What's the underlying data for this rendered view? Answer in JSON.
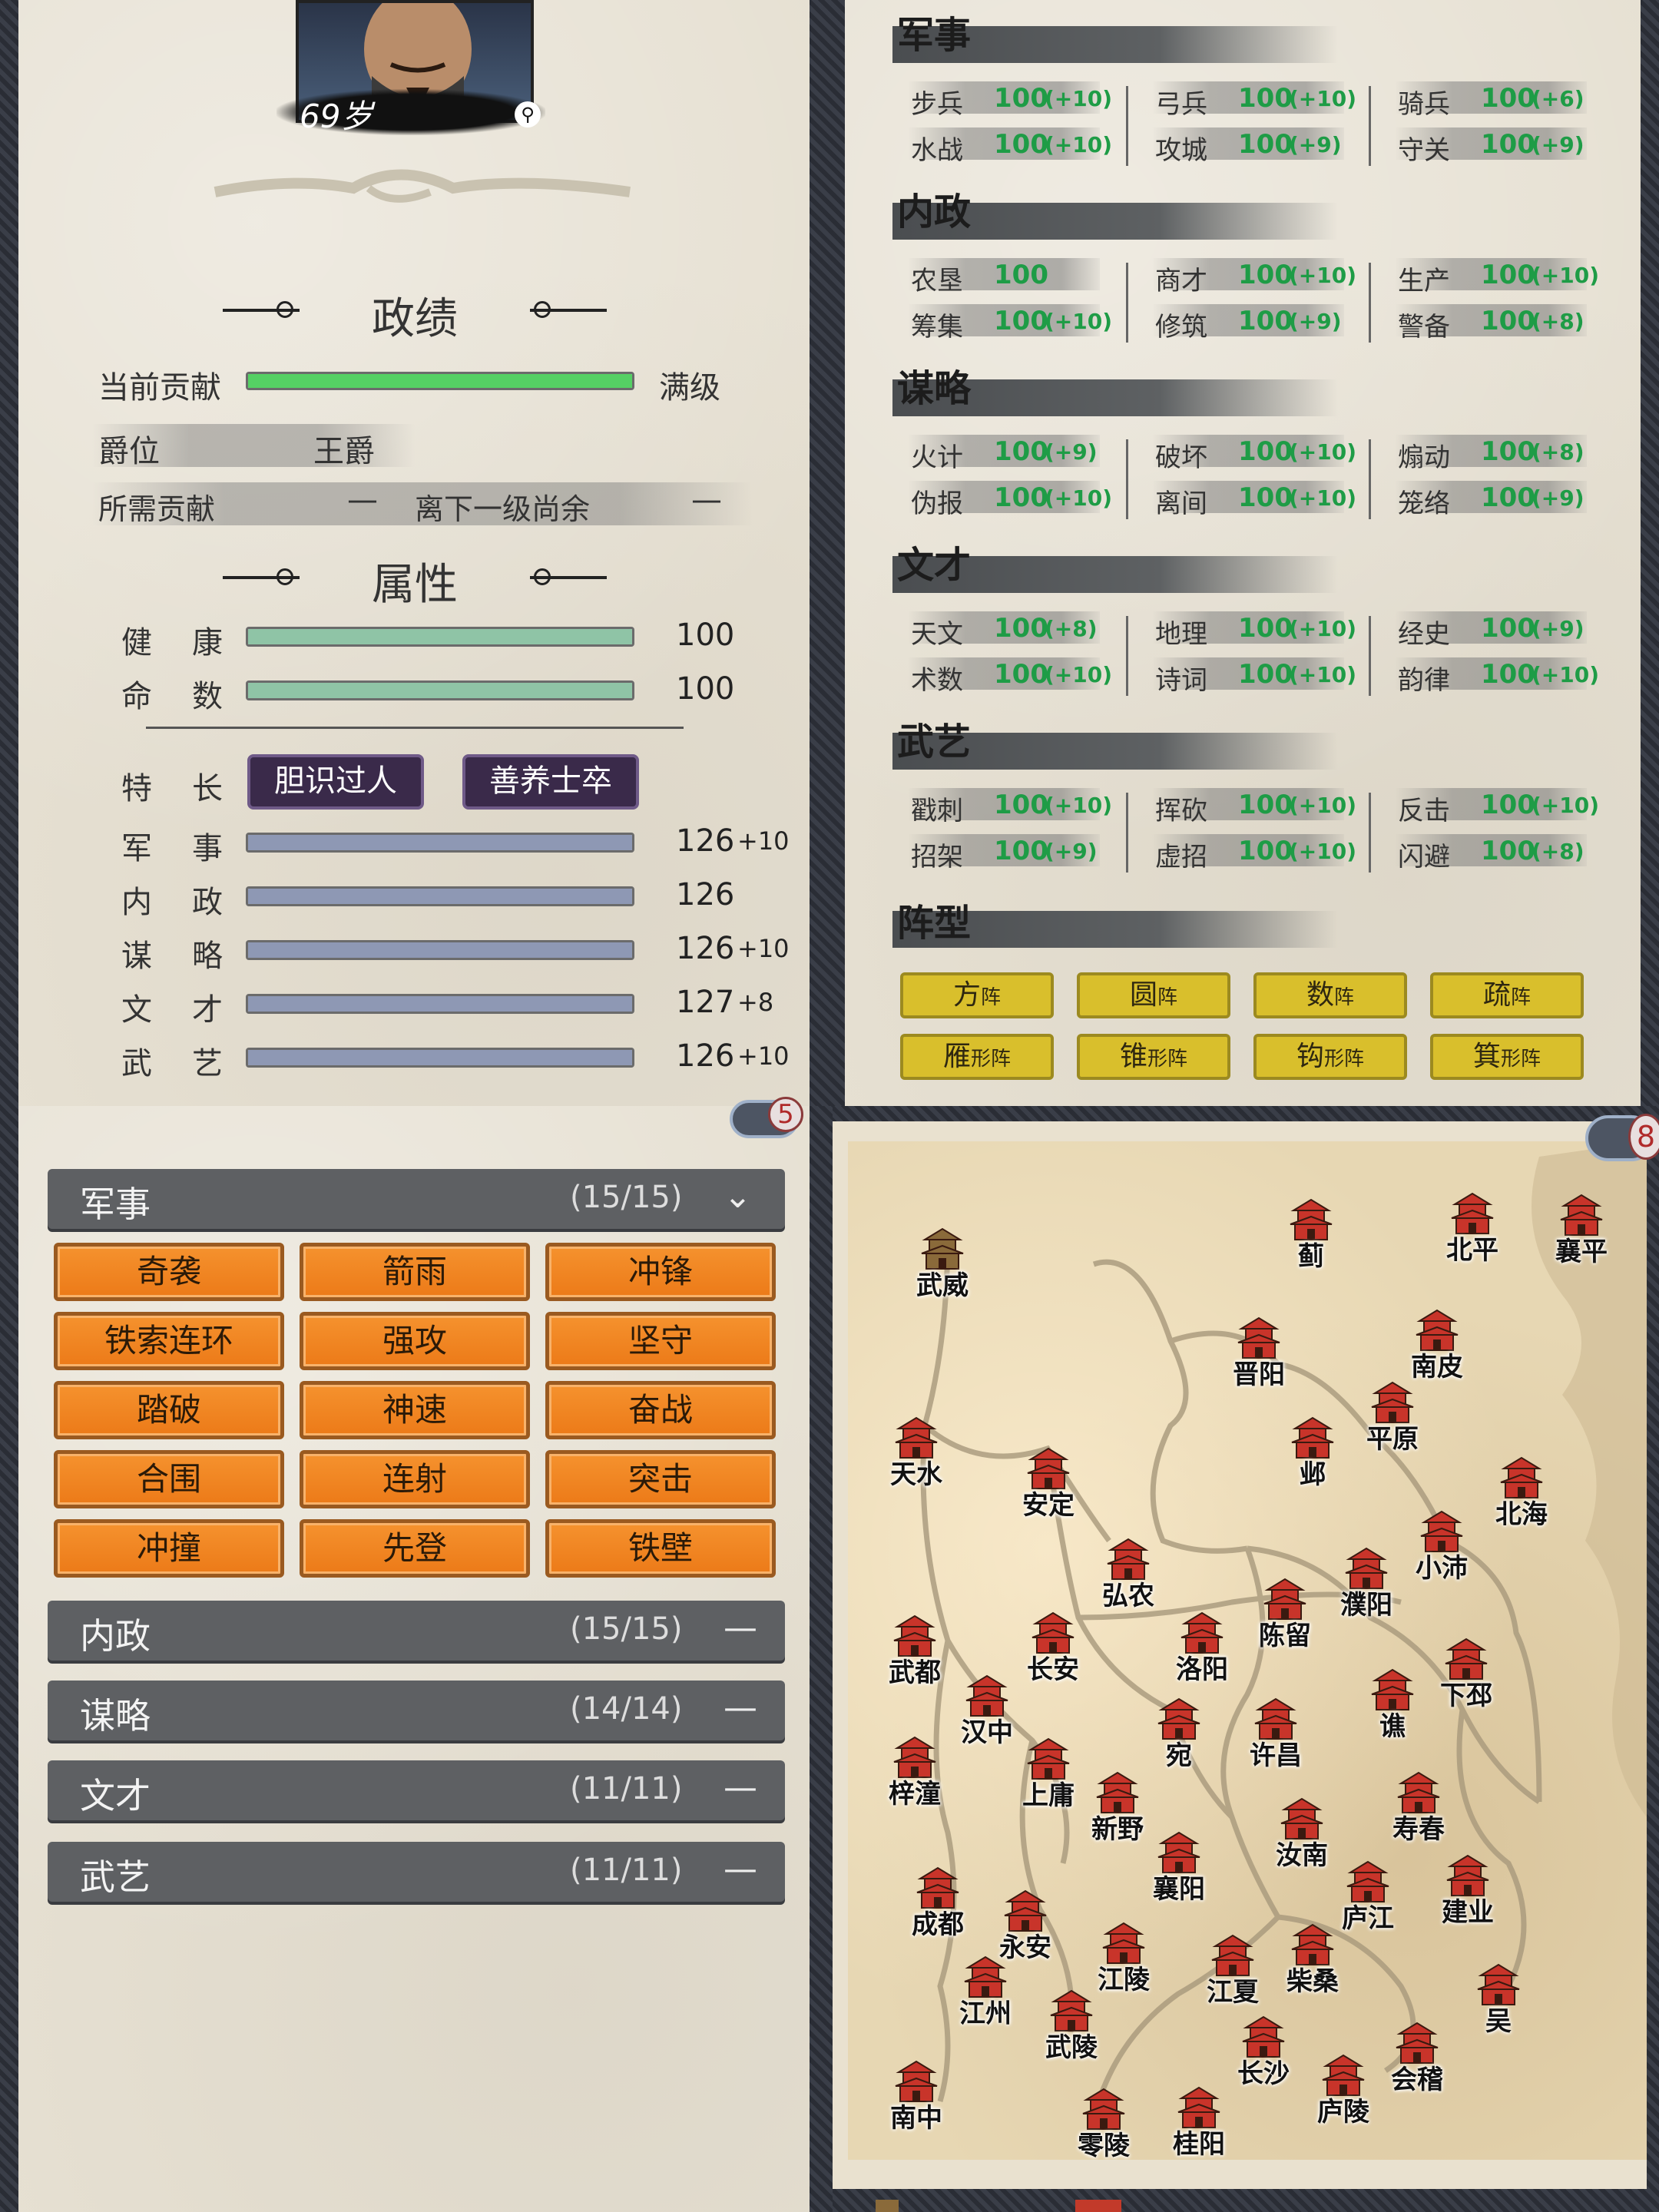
{
  "portrait": {
    "age": "69岁"
  },
  "achievement": {
    "title": "政绩",
    "contribution_label": "当前贡献",
    "contribution_status": "满级",
    "contribution_fill": 1.0,
    "rank_label": "爵位",
    "rank_value": "王爵",
    "needed_label": "所需贡献",
    "needed_value": "—",
    "remain_label": "离下一级尚余",
    "remain_value": "—"
  },
  "attributes": {
    "title": "属性",
    "health": {
      "label1": "健",
      "label2": "康",
      "value": "100",
      "fill": 1.0
    },
    "fate": {
      "label1": "命",
      "label2": "数",
      "value": "100",
      "fill": 1.0
    },
    "specialty": {
      "label1": "特",
      "label2": "长",
      "tags": [
        "胆识过人",
        "善养士卒"
      ]
    },
    "stats": [
      {
        "l1": "军",
        "l2": "事",
        "value": "126",
        "bonus": "+10"
      },
      {
        "l1": "内",
        "l2": "政",
        "value": "126",
        "bonus": ""
      },
      {
        "l1": "谋",
        "l2": "略",
        "value": "126",
        "bonus": "+10"
      },
      {
        "l1": "文",
        "l2": "才",
        "value": "127",
        "bonus": "+8"
      },
      {
        "l1": "武",
        "l2": "艺",
        "value": "126",
        "bonus": "+10"
      }
    ]
  },
  "skills": {
    "sections": [
      {
        "name": "军事",
        "rows": [
          [
            {
              "n": "步兵",
              "v": "100",
              "b": "(+10)"
            },
            {
              "n": "弓兵",
              "v": "100",
              "b": "(+10)"
            },
            {
              "n": "骑兵",
              "v": "100",
              "b": "(+6)"
            }
          ],
          [
            {
              "n": "水战",
              "v": "100",
              "b": "(+10)"
            },
            {
              "n": "攻城",
              "v": "100",
              "b": "(+9)"
            },
            {
              "n": "守关",
              "v": "100",
              "b": "(+9)"
            }
          ]
        ]
      },
      {
        "name": "内政",
        "rows": [
          [
            {
              "n": "农垦",
              "v": "100",
              "b": ""
            },
            {
              "n": "商才",
              "v": "100",
              "b": "(+10)"
            },
            {
              "n": "生产",
              "v": "100",
              "b": "(+10)"
            }
          ],
          [
            {
              "n": "筹集",
              "v": "100",
              "b": "(+10)"
            },
            {
              "n": "修筑",
              "v": "100",
              "b": "(+9)"
            },
            {
              "n": "警备",
              "v": "100",
              "b": "(+8)"
            }
          ]
        ]
      },
      {
        "name": "谋略",
        "rows": [
          [
            {
              "n": "火计",
              "v": "100",
              "b": "(+9)"
            },
            {
              "n": "破坏",
              "v": "100",
              "b": "(+10)"
            },
            {
              "n": "煽动",
              "v": "100",
              "b": "(+8)"
            }
          ],
          [
            {
              "n": "伪报",
              "v": "100",
              "b": "(+10)"
            },
            {
              "n": "离间",
              "v": "100",
              "b": "(+10)"
            },
            {
              "n": "笼络",
              "v": "100",
              "b": "(+9)"
            }
          ]
        ]
      },
      {
        "name": "文才",
        "rows": [
          [
            {
              "n": "天文",
              "v": "100",
              "b": "(+8)"
            },
            {
              "n": "地理",
              "v": "100",
              "b": "(+10)"
            },
            {
              "n": "经史",
              "v": "100",
              "b": "(+9)"
            }
          ],
          [
            {
              "n": "术数",
              "v": "100",
              "b": "(+10)"
            },
            {
              "n": "诗词",
              "v": "100",
              "b": "(+10)"
            },
            {
              "n": "韵律",
              "v": "100",
              "b": "(+10)"
            }
          ]
        ]
      },
      {
        "name": "武艺",
        "rows": [
          [
            {
              "n": "戳刺",
              "v": "100",
              "b": "(+10)"
            },
            {
              "n": "挥砍",
              "v": "100",
              "b": "(+10)"
            },
            {
              "n": "反击",
              "v": "100",
              "b": "(+10)"
            }
          ],
          [
            {
              "n": "招架",
              "v": "100",
              "b": "(+9)"
            },
            {
              "n": "虚招",
              "v": "100",
              "b": "(+10)"
            },
            {
              "n": "闪避",
              "v": "100",
              "b": "(+8)"
            }
          ]
        ]
      }
    ],
    "formation_title": "阵型",
    "formations": [
      {
        "main": "方",
        "sub": "阵"
      },
      {
        "main": "圆",
        "sub": "阵"
      },
      {
        "main": "数",
        "sub": "阵"
      },
      {
        "main": "疏",
        "sub": "阵"
      },
      {
        "main": "雁",
        "sub": "形阵"
      },
      {
        "main": "锥",
        "sub": "形阵"
      },
      {
        "main": "钩",
        "sub": "形阵"
      },
      {
        "main": "箕",
        "sub": "形阵"
      }
    ]
  },
  "badges": {
    "left": "5",
    "right": "8"
  },
  "categories": {
    "military": {
      "name": "军事",
      "count": "(15/15)",
      "expanded": true
    },
    "tactics": [
      "奇袭",
      "箭雨",
      "冲锋",
      "铁索连环",
      "强攻",
      "坚守",
      "踏破",
      "神速",
      "奋战",
      "合围",
      "连射",
      "突击",
      "冲撞",
      "先登",
      "铁壁"
    ],
    "collapsed": [
      {
        "name": "内政",
        "count": "(15/15)"
      },
      {
        "name": "谋略",
        "count": "(14/14)"
      },
      {
        "name": "文才",
        "count": "(11/11)"
      },
      {
        "name": "武艺",
        "count": "(11/11)"
      }
    ]
  },
  "map": {
    "cities": [
      "武威",
      "蓟",
      "北平",
      "襄平",
      "南皮",
      "晋阳",
      "平原",
      "邺",
      "天水",
      "安定",
      "北海",
      "小沛",
      "濮阳",
      "弘农",
      "陈留",
      "武都",
      "长安",
      "洛阳",
      "下邳",
      "汉中",
      "谯",
      "宛",
      "许昌",
      "梓潼",
      "上庸",
      "新野",
      "寿春",
      "汝南",
      "襄阳",
      "庐江",
      "建业",
      "成都",
      "永安",
      "江陵",
      "江夏",
      "柴桑",
      "江州",
      "吴",
      "武陵",
      "长沙",
      "会稽",
      "南中",
      "庐陵",
      "零陵",
      "桂阳"
    ],
    "highlight_city": "武威"
  }
}
